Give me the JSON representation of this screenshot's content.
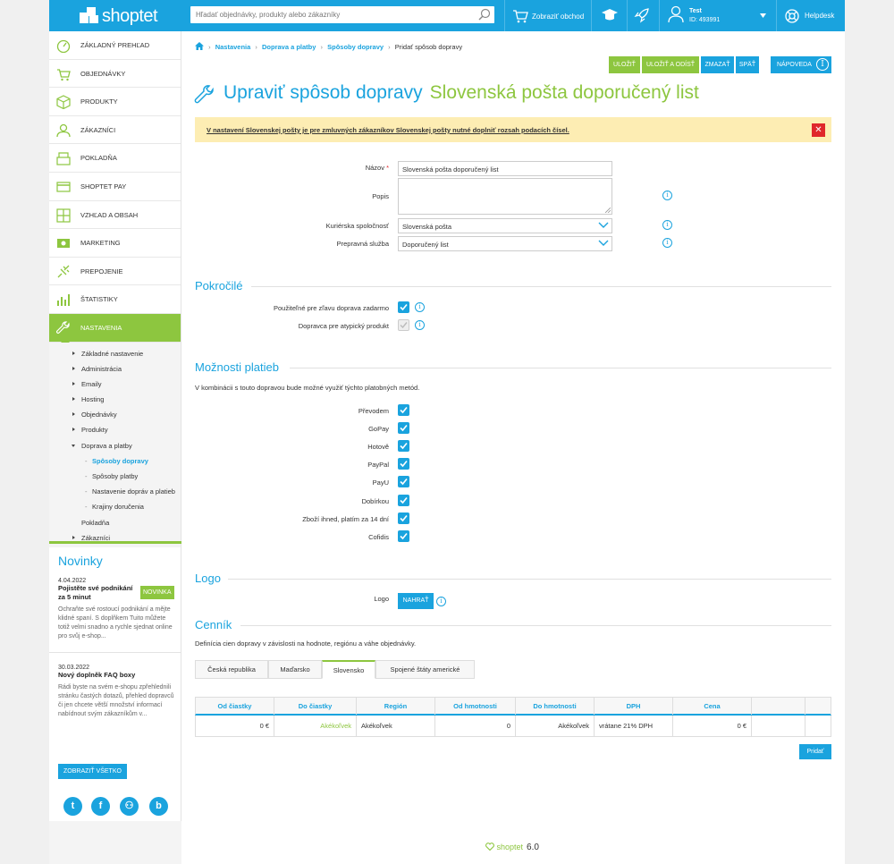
{
  "header": {
    "logo": "shoptet",
    "search_placeholder": "Hľadať objednávky, produkty alebo zákazníky",
    "view_shop": "Zobraziť obchod",
    "user_name": "Test",
    "user_id": "ID: 493991",
    "helpdesk": "Helpdesk"
  },
  "sidebar": {
    "items": [
      {
        "label": "Základný prehľad",
        "icon": "dashboard-icon"
      },
      {
        "label": "Objednávky",
        "icon": "cart-icon"
      },
      {
        "label": "Produkty",
        "icon": "box-icon"
      },
      {
        "label": "Zákazníci",
        "icon": "user-icon"
      },
      {
        "label": "Pokladňa",
        "icon": "register-icon"
      },
      {
        "label": "Shoptet Pay",
        "icon": "card-icon"
      },
      {
        "label": "Vzhľad a obsah",
        "icon": "layout-icon"
      },
      {
        "label": "Marketing",
        "icon": "money-icon"
      },
      {
        "label": "Prepojenie",
        "icon": "plug-icon"
      },
      {
        "label": "Štatistiky",
        "icon": "chart-icon"
      },
      {
        "label": "Nastavenia",
        "icon": "wrench-icon"
      }
    ],
    "sub": [
      "Základné nastavenie",
      "Administrácia",
      "Emaily",
      "Hosting",
      "Objednávky",
      "Produkty",
      "Doprava a platby"
    ],
    "sub2": [
      "Spôsoby dopravy",
      "Spôsoby platby",
      "Nastavenie dopráv a platieb",
      "Krajiny doručenia"
    ],
    "sub_tail": [
      "Pokladňa",
      "Zákazníci"
    ]
  },
  "news": {
    "heading": "Novinky",
    "items": [
      {
        "date": "4.04.2022",
        "title": "Pojistěte své podnikání za 5 minut",
        "badge": "Novinka",
        "text": "Ochraňte své rostoucí podnikání a mějte klidné spaní. S doplňkem Tuito můžete totiž velmi snadno a rychle sjednat online pro svůj e-shop..."
      },
      {
        "date": "30.03.2022",
        "title": "Nový doplněk FAQ boxy",
        "text": "Rádi byste na svém e-shopu zpřehlednili stránku častých dotazů, přehled dopravců či jen chcete větší množství informací nabídnout svým zákazníkům v..."
      }
    ],
    "show_all": "Zobraziť všetko",
    "socials": [
      "t",
      "f",
      "⚇",
      "b"
    ]
  },
  "breadcrumb": [
    "Nastavenia",
    "Doprava a platby",
    "Spôsoby dopravy"
  ],
  "breadcrumb_current": "Pridať spôsob dopravy",
  "toolbar": {
    "save": "Uložiť",
    "save_exit": "Uložiť a odísť",
    "delete": "Zmazať",
    "back": "Späť",
    "help": "Nápoveda"
  },
  "page": {
    "title": "Upraviť spôsob dopravy",
    "name": "Slovenská pošta doporučený list"
  },
  "alert": "V nastavení Slovenskej pošty je pre zmluvných zákazníkov Slovenskej pošty nutné doplniť rozsah podacích čísel.",
  "form": {
    "name_label": "Názov",
    "name_value": "Slovenská pošta doporučený list",
    "desc_label": "Popis",
    "courier_label": "Kuriérska spoločnosť",
    "courier_value": "Slovenská pošta",
    "service_label": "Prepravná služba",
    "service_value": "Doporučený list"
  },
  "advanced": {
    "heading": "Pokročilé",
    "free_shipping": "Použiteľné pre zľavu doprava zadarmo",
    "atypical": "Dopravca pre atypický produkt"
  },
  "payments": {
    "heading": "Možnosti platieb",
    "desc": "V kombinácii s touto dopravou bude možné využiť týchto platobných metód.",
    "methods": [
      "Převodem",
      "GoPay",
      "Hotově",
      "PayPal",
      "PayU",
      "Dobírkou",
      "Zboží ihned, platím za 14 dní",
      "Cofidis"
    ]
  },
  "logo": {
    "heading": "Logo",
    "label": "Logo",
    "upload": "Nahrať"
  },
  "pricing": {
    "heading": "Cenník",
    "desc": "Definícia cien dopravy v závislosti na hodnote, regiónu a váhe objednávky.",
    "tabs": [
      "Česká republika",
      "Maďarsko",
      "Slovensko",
      "Spojené štáty americké"
    ],
    "columns": [
      "Od čiastky",
      "Do čiastky",
      "Región",
      "Od hmotnosti",
      "Do hmotnosti",
      "DPH",
      "Cena"
    ],
    "row": [
      "0 €",
      "Akékoľvek",
      "Akékoľvek",
      "0",
      "Akékoľvek",
      "vrátane 21% DPH",
      "0 €"
    ],
    "add": "Pridať"
  },
  "footer": {
    "brand": "shoptet",
    "version": "6.0"
  },
  "colors": {
    "accent": "#1aa3de",
    "green": "#8dc63f",
    "alert": "#fdedb3",
    "danger": "#e0272b"
  }
}
